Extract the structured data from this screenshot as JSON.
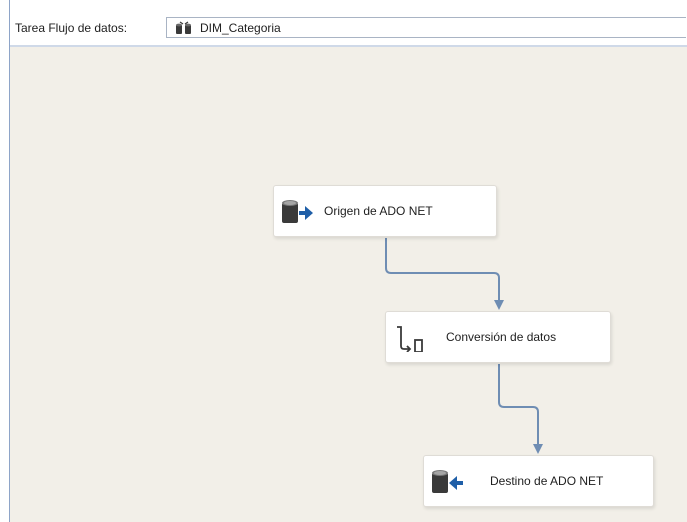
{
  "toolbar": {
    "label": "Tarea Flujo de datos:",
    "task_value": "DIM_Categoria"
  },
  "nodes": [
    {
      "label": "Origen de ADO NET",
      "icon": "ado-net-source-icon"
    },
    {
      "label": "Conversión de datos",
      "icon": "data-conversion-icon"
    },
    {
      "label": "Destino de ADO NET",
      "icon": "ado-net-destination-icon"
    }
  ],
  "colors": {
    "canvas": "#f2efe8",
    "connector": "#6f8db3",
    "source_arrow": "#1f5fa8",
    "destination_arrow": "#1f5fa8",
    "db_cylinder": "#3a3a3a"
  }
}
